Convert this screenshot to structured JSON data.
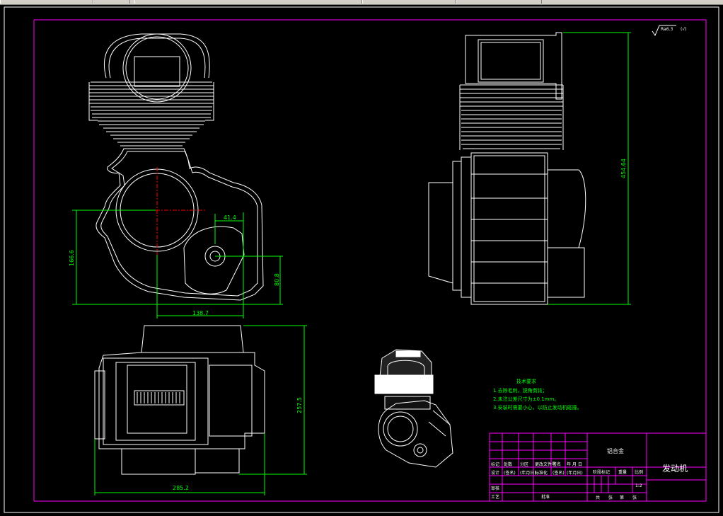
{
  "dimensions": {
    "d_166_6": "166.6",
    "d_41_4": "41.4",
    "d_80_8": "80.8",
    "d_138_7": "138.7",
    "d_454_64": "454.64",
    "d_257_5": "257.5",
    "d_285_2": "285.2"
  },
  "roughness": {
    "value": "Ra6.3",
    "paren": "(√)"
  },
  "tech_notes": {
    "title": "技术要求",
    "line1": "1.去除毛刺，锐角倒钝；",
    "line2": "2.未注公差尺寸为±0.1mm。",
    "line3": "3.安装时需要小心，以防止发动机碰撞。"
  },
  "title_block": {
    "material": "铝合金",
    "part_name": "发动机",
    "scale": "1:2",
    "row1": [
      "标记",
      "处数",
      "分区",
      "更改文件号",
      "签名",
      "年 月 日"
    ],
    "row2": [
      "设计",
      "(签名)",
      "(年月日)",
      "标准化",
      "(签名)",
      "(年月日)"
    ],
    "stage_label": "阶段标记",
    "weight_label": "重量",
    "scale_label": "比例",
    "audit": "审核",
    "process": "工艺",
    "approve": "批准",
    "sheets": [
      "共",
      "张",
      "第",
      "张"
    ]
  },
  "colors": {
    "background": "#000000",
    "frame": "#ff00ff",
    "geometry": "#ffffff",
    "dimension": "#00ff00",
    "centerline": "#ff0000"
  }
}
